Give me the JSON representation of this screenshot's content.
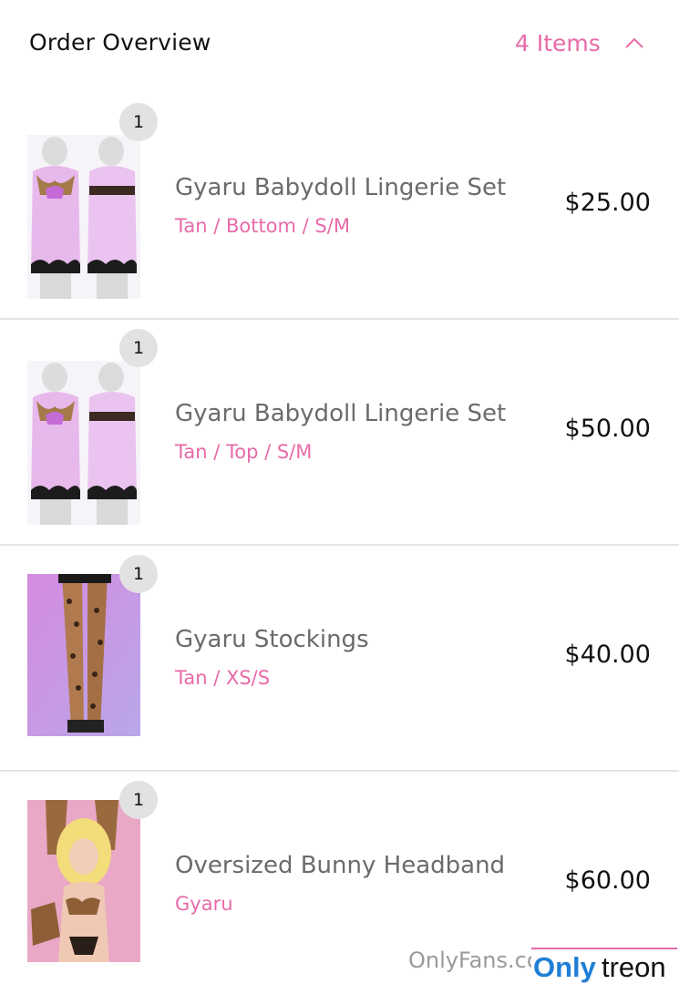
{
  "header": {
    "title": "Order Overview",
    "item_count": "4 Items"
  },
  "items": [
    {
      "quantity": "1",
      "name": "Gyaru Babydoll Lingerie Set",
      "variant": "Tan / Bottom / S/M",
      "price": "$25.00"
    },
    {
      "quantity": "1",
      "name": "Gyaru Babydoll Lingerie Set",
      "variant": "Tan / Top / S/M",
      "price": "$50.00"
    },
    {
      "quantity": "1",
      "name": "Gyaru Stockings",
      "variant": "Tan / XS/S",
      "price": "$40.00"
    },
    {
      "quantity": "1",
      "name": "Oversized Bunny Headband",
      "variant": "Gyaru",
      "price": "$60.00"
    }
  ],
  "watermark": {
    "text": "OnlyFans.com",
    "logo_left": "Only",
    "logo_right": "treon"
  },
  "colors": {
    "accent_pink": "#e86aa8",
    "badge_gray": "#e2e2e2",
    "logo_blue": "#1f7fd6"
  }
}
